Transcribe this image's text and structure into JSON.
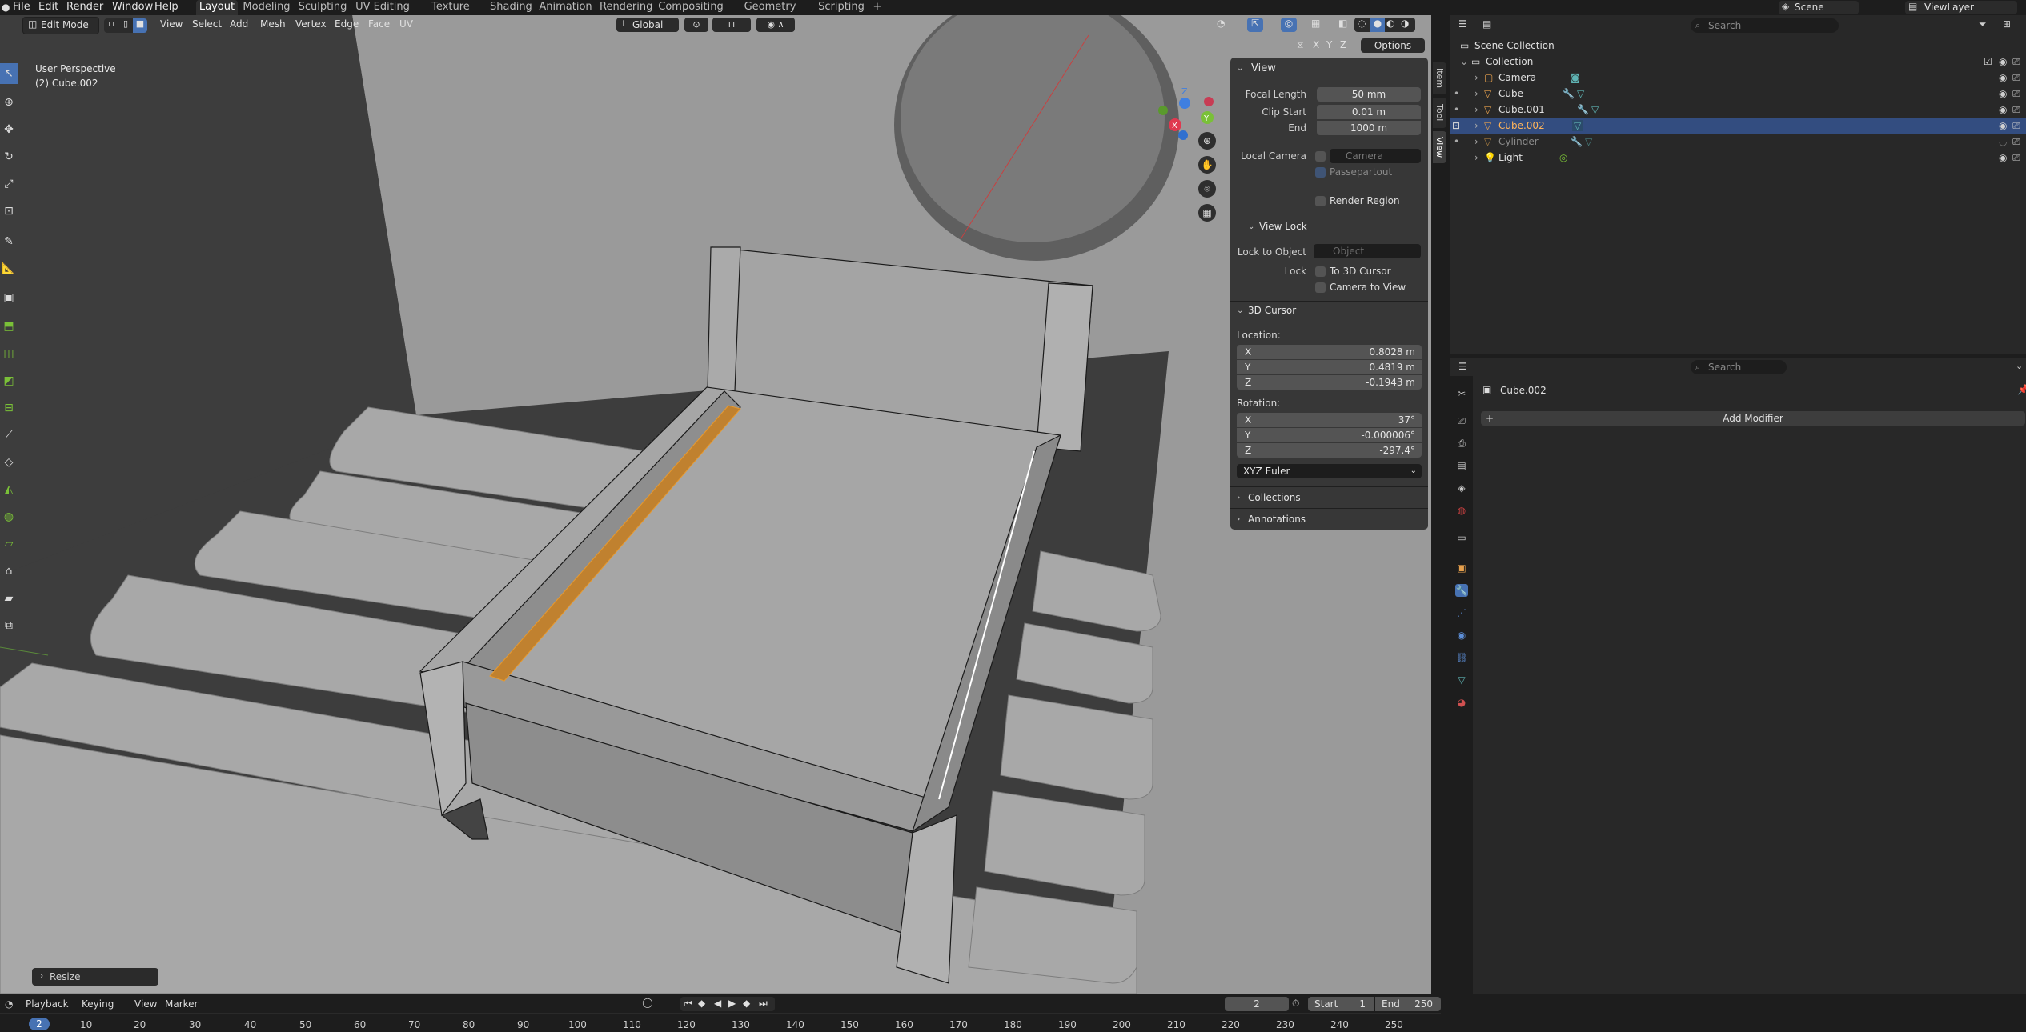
{
  "topbar": {
    "menus": [
      "File",
      "Edit",
      "Render",
      "Window",
      "Help"
    ],
    "workspaces": [
      "Layout",
      "Modeling",
      "Sculpting",
      "UV Editing",
      "Texture Paint",
      "Shading",
      "Animation",
      "Rendering",
      "Compositing",
      "Geometry Nodes",
      "Scripting"
    ],
    "add_tab": "+",
    "scene": "Scene",
    "view_layer": "ViewLayer"
  },
  "viewport_header": {
    "mode": "Edit Mode",
    "menus": [
      "View",
      "Select",
      "Add",
      "Mesh",
      "Vertex",
      "Edge",
      "Face",
      "UV"
    ],
    "orientation": "Global",
    "options": "Options",
    "axes": [
      "X",
      "Y",
      "Z"
    ]
  },
  "viewport": {
    "perspective": "User Perspective",
    "object": "(2) Cube.002",
    "last_op": "Resize"
  },
  "npanel": {
    "view": {
      "title": "View",
      "focal_length_label": "Focal Length",
      "focal_length": "50 mm",
      "clip_start_label": "Clip Start",
      "clip_start": "0.01 m",
      "end_label": "End",
      "end": "1000 m",
      "local_camera_label": "Local Camera",
      "local_camera": "Camera",
      "passepartout": "Passepartout",
      "render_region": "Render Region"
    },
    "view_lock": {
      "title": "View Lock",
      "lock_to_object_label": "Lock to Object",
      "lock_to_object_placeholder": "Object",
      "lock_label": "Lock",
      "to_3d_cursor": "To 3D Cursor",
      "camera_to_view": "Camera to View"
    },
    "cursor": {
      "title": "3D Cursor",
      "location_label": "Location:",
      "loc_x": "0.8028 m",
      "loc_y": "0.4819 m",
      "loc_z": "-0.1943 m",
      "rotation_label": "Rotation:",
      "rot_x": "37°",
      "rot_y": "-0.000006°",
      "rot_z": "-297.4°",
      "rotation_mode": "XYZ Euler",
      "axis_x": "X",
      "axis_y": "Y",
      "axis_z": "Z"
    },
    "collections": "Collections",
    "annotations": "Annotations",
    "tabs": [
      "Item",
      "Tool",
      "View"
    ]
  },
  "outliner": {
    "search_placeholder": "Search",
    "root": "Scene Collection",
    "collection": "Collection",
    "items": [
      {
        "name": "Camera",
        "color": "#e6a04d"
      },
      {
        "name": "Cube",
        "color": "#e6a04d"
      },
      {
        "name": "Cube.001",
        "color": "#e6a04d"
      },
      {
        "name": "Cube.002",
        "color": "#e6a04d"
      },
      {
        "name": "Cylinder",
        "color": "#e6a04d"
      },
      {
        "name": "Light",
        "color": "#e6a04d"
      }
    ]
  },
  "properties": {
    "search_placeholder": "Search",
    "object_name": "Cube.002",
    "add_modifier": "Add Modifier"
  },
  "timeline": {
    "menus": [
      "Playback",
      "Keying",
      "View",
      "Marker"
    ],
    "current_frame": "2",
    "start_label": "Start",
    "start": "1",
    "end_label": "End",
    "end": "250",
    "ticks": [
      "2",
      "10",
      "20",
      "30",
      "40",
      "50",
      "60",
      "70",
      "80",
      "90",
      "100",
      "110",
      "120",
      "130",
      "140",
      "150",
      "160",
      "170",
      "180",
      "190",
      "200",
      "210",
      "220",
      "230",
      "240",
      "250"
    ]
  },
  "colors": {
    "accent": "#4772b3",
    "selected_row": "#334d80",
    "edge_select": "#e89a2e",
    "object_orange": "#e6a04d"
  }
}
